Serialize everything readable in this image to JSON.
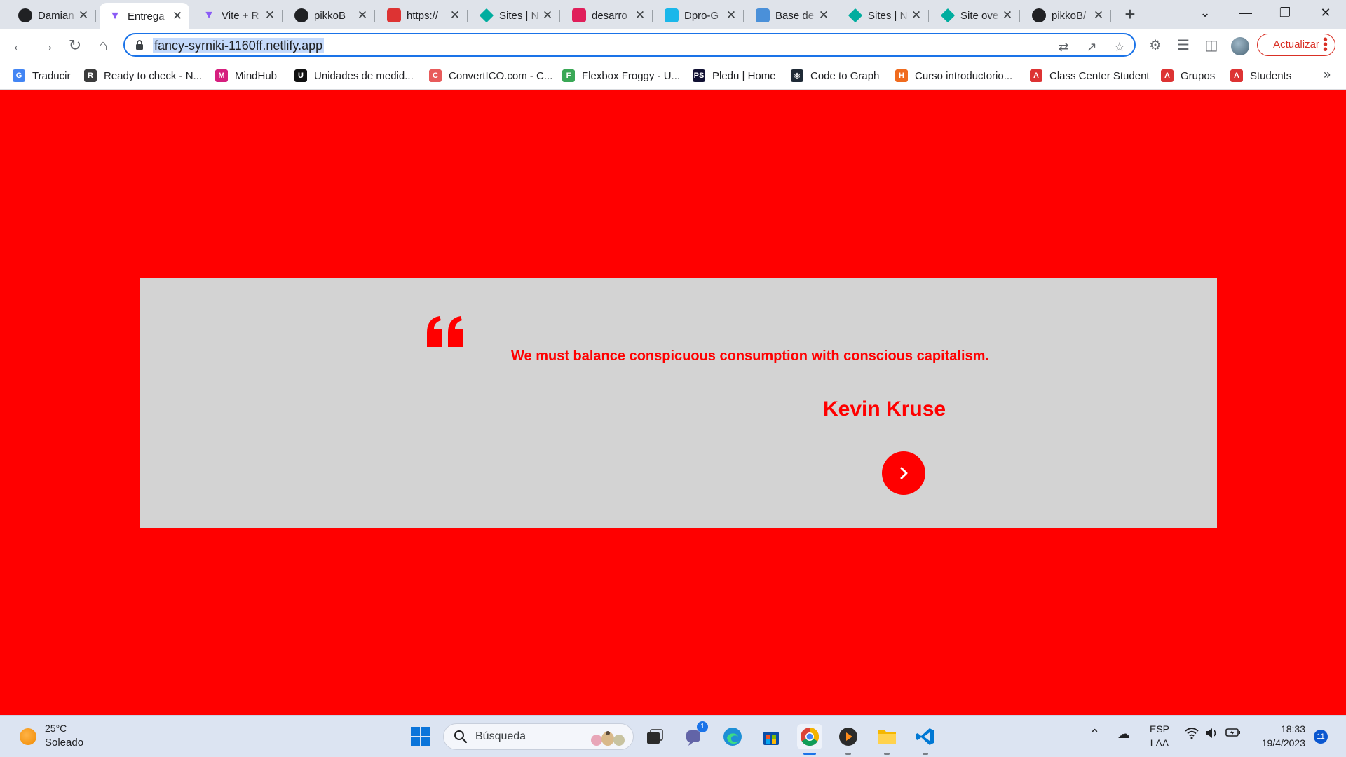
{
  "browser": {
    "tabs": [
      {
        "title": "Damian",
        "favicon": "circle-logo-icon",
        "color": "#202124",
        "active": false
      },
      {
        "title": "Entrega",
        "favicon": "vite-icon",
        "color": "#8b5cf6",
        "active": true
      },
      {
        "title": "Vite + R",
        "favicon": "vite-icon",
        "color": "#8b5cf6",
        "active": false
      },
      {
        "title": "pikkoB",
        "favicon": "github-icon",
        "color": "#202124",
        "active": false
      },
      {
        "title": "https://",
        "favicon": "angular-icon",
        "color": "#dd3333",
        "active": false
      },
      {
        "title": "Sites | N",
        "favicon": "netlify-icon",
        "color": "#00ad9f",
        "active": false
      },
      {
        "title": "desarro",
        "favicon": "slack-icon",
        "color": "#e01e5a",
        "active": false
      },
      {
        "title": "Dpro-G",
        "favicon": "vimeo-icon",
        "color": "#1ab7ea",
        "active": false
      },
      {
        "title": "Base de",
        "favicon": "monitor-icon",
        "color": "#4a90d9",
        "active": false
      },
      {
        "title": "Sites | N",
        "favicon": "netlify-icon",
        "color": "#00ad9f",
        "active": false
      },
      {
        "title": "Site ove",
        "favicon": "netlify-icon",
        "color": "#00ad9f",
        "active": false
      },
      {
        "title": "pikkoB/",
        "favicon": "github-icon",
        "color": "#202124",
        "active": false
      }
    ],
    "url": "fancy-syrniki-1160ff.netlify.app",
    "update_label": "Actualizar",
    "bookmarks": [
      {
        "label": "Traducir",
        "color": "#4285f4",
        "glyph": "G"
      },
      {
        "label": "Ready to check - N...",
        "color": "#3c3c3c",
        "glyph": "R"
      },
      {
        "label": "MindHub",
        "color": "#d61f7e",
        "glyph": "M"
      },
      {
        "label": "Unidades de medid...",
        "color": "#111111",
        "glyph": "U"
      },
      {
        "label": "ConvertICO.com - C...",
        "color": "#e85b5b",
        "glyph": "C"
      },
      {
        "label": "Flexbox Froggy - U...",
        "color": "#3aa856",
        "glyph": "F"
      },
      {
        "label": "Pledu | Home",
        "color": "#111133",
        "glyph": "PS"
      },
      {
        "label": "Code to Graph",
        "color": "#1f2a36",
        "glyph": "⚛"
      },
      {
        "label": "Curso introductorio...",
        "color": "#f06b1e",
        "glyph": "H"
      },
      {
        "label": "Class Center Student",
        "color": "#dd3333",
        "glyph": "A"
      },
      {
        "label": "Grupos",
        "color": "#dd3333",
        "glyph": "A"
      },
      {
        "label": "Students",
        "color": "#dd3333",
        "glyph": "A"
      }
    ]
  },
  "page": {
    "quote": "We must balance conspicuous consumption with conscious capitalism.",
    "author": "Kevin Kruse",
    "colors": {
      "background": "#ff0000",
      "card": "#d3d3d3",
      "accent": "#ff0000"
    }
  },
  "taskbar": {
    "weather_temp": "25°C",
    "weather_condition": "Soleado",
    "search_placeholder": "Búsqueda",
    "teams_badge": "1",
    "lang_line1": "ESP",
    "lang_line2": "LAA",
    "time": "18:33",
    "date": "19/4/2023",
    "notifications": "11"
  }
}
